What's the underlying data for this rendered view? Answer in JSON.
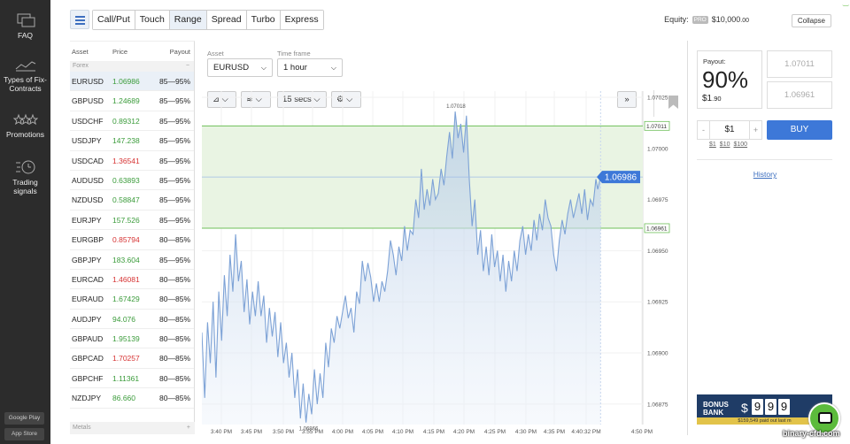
{
  "sidebar": {
    "items": [
      {
        "label": "FAQ",
        "icon": "faq-icon"
      },
      {
        "label": "Types of Fix-Contracts",
        "icon": "chart-icon"
      },
      {
        "label": "Promotions",
        "icon": "stars-icon"
      },
      {
        "label": "Trading signals",
        "icon": "clock-icon"
      }
    ],
    "stores": [
      "Google Play",
      "App Store"
    ]
  },
  "header": {
    "tabs": [
      "Call/Put",
      "Touch",
      "Range",
      "Spread",
      "Turbo",
      "Express"
    ],
    "active_tab": "Range",
    "equity_label": "Equity:",
    "pro_badge": "PRO",
    "equity_value": "$10,000",
    "equity_cents": ".00",
    "collapse_label": "Collapse"
  },
  "assets": {
    "columns": [
      "Asset",
      "Price",
      "Payout"
    ],
    "group": "Forex",
    "group2": "Metals",
    "rows": [
      {
        "name": "EURUSD",
        "price": "1.06986",
        "payout": "85—95%",
        "dir": "up"
      },
      {
        "name": "GBPUSD",
        "price": "1.24689",
        "payout": "85—95%",
        "dir": "up"
      },
      {
        "name": "USDCHF",
        "price": "0.89312",
        "payout": "85—95%",
        "dir": "up"
      },
      {
        "name": "USDJPY",
        "price": "147.238",
        "payout": "85—95%",
        "dir": "up"
      },
      {
        "name": "USDCAD",
        "price": "1.36541",
        "payout": "85—95%",
        "dir": "down"
      },
      {
        "name": "AUDUSD",
        "price": "0.63893",
        "payout": "85—95%",
        "dir": "up"
      },
      {
        "name": "NZDUSD",
        "price": "0.58847",
        "payout": "85—95%",
        "dir": "up"
      },
      {
        "name": "EURJPY",
        "price": "157.526",
        "payout": "85—95%",
        "dir": "up"
      },
      {
        "name": "EURGBP",
        "price": "0.85794",
        "payout": "80—85%",
        "dir": "down"
      },
      {
        "name": "GBPJPY",
        "price": "183.604",
        "payout": "85—95%",
        "dir": "up"
      },
      {
        "name": "EURCAD",
        "price": "1.46081",
        "payout": "80—85%",
        "dir": "down"
      },
      {
        "name": "EURAUD",
        "price": "1.67429",
        "payout": "80—85%",
        "dir": "up"
      },
      {
        "name": "AUDJPY",
        "price": "94.076",
        "payout": "80—85%",
        "dir": "up"
      },
      {
        "name": "GBPAUD",
        "price": "1.95139",
        "payout": "80—85%",
        "dir": "up"
      },
      {
        "name": "GBPCAD",
        "price": "1.70257",
        "payout": "80—85%",
        "dir": "down"
      },
      {
        "name": "GBPCHF",
        "price": "1.11361",
        "payout": "80—85%",
        "dir": "up"
      },
      {
        "name": "NZDJPY",
        "price": "86.660",
        "payout": "80—85%",
        "dir": "up"
      }
    ]
  },
  "controls": {
    "asset_label": "Asset",
    "asset_value": "EURUSD",
    "timeframe_label": "Time frame",
    "timeframe_value": "1 hour",
    "interval": "15 secs"
  },
  "colors": {
    "accent": "#3d78d8",
    "up": "#3a9b3a",
    "down": "#d63333",
    "range": "#6fbf5a"
  },
  "chart_data": {
    "type": "area",
    "x_ticks": [
      "3:40 PM",
      "3:45 PM",
      "3:50 PM",
      "3:55 PM",
      "4:00 PM",
      "4:05 PM",
      "4:10 PM",
      "4:15 PM",
      "4:20 PM",
      "4:25 PM",
      "4:30 PM",
      "4:35 PM",
      "4:40:32 PM",
      "4:50 PM"
    ],
    "y_ticks": [
      "1.07025",
      "1.07000",
      "1.06975",
      "1.06950",
      "1.06925",
      "1.06900",
      "1.06875"
    ],
    "ylim": [
      1.06865,
      1.07028
    ],
    "range_upper": "1.07011",
    "range_lower": "1.06961",
    "current": "1.06986",
    "max_label": "1.07018",
    "min_label": "1.06866",
    "t_start": 38,
    "t_end": 80.5,
    "series": [
      {
        "values": [
          [
            38,
            1.0691
          ],
          [
            38.3,
            1.06878
          ],
          [
            38.6,
            1.06915
          ],
          [
            38.9,
            1.06895
          ],
          [
            39.2,
            1.06925
          ],
          [
            39.5,
            1.06888
          ],
          [
            39.8,
            1.0693
          ],
          [
            40.1,
            1.06906
          ],
          [
            40.4,
            1.06938
          ],
          [
            40.7,
            1.06918
          ],
          [
            41,
            1.06948
          ],
          [
            41.3,
            1.0693
          ],
          [
            41.6,
            1.06958
          ],
          [
            41.9,
            1.06935
          ],
          [
            42.2,
            1.06945
          ],
          [
            42.5,
            1.0692
          ],
          [
            42.8,
            1.06936
          ],
          [
            43.1,
            1.06914
          ],
          [
            43.4,
            1.0693
          ],
          [
            43.7,
            1.06918
          ],
          [
            44,
            1.06935
          ],
          [
            44.3,
            1.06918
          ],
          [
            44.6,
            1.06928
          ],
          [
            44.9,
            1.06905
          ],
          [
            45.2,
            1.06922
          ],
          [
            45.5,
            1.06908
          ],
          [
            45.8,
            1.0692
          ],
          [
            46.1,
            1.06898
          ],
          [
            46.4,
            1.06915
          ],
          [
            46.7,
            1.06895
          ],
          [
            47,
            1.06905
          ],
          [
            47.3,
            1.06888
          ],
          [
            47.6,
            1.069
          ],
          [
            47.9,
            1.06878
          ],
          [
            48.2,
            1.06892
          ],
          [
            48.5,
            1.06868
          ],
          [
            48.8,
            1.06885
          ],
          [
            49.1,
            1.06866
          ],
          [
            49.4,
            1.0688
          ],
          [
            49.7,
            1.0687
          ],
          [
            50,
            1.06892
          ],
          [
            50.3,
            1.06875
          ],
          [
            50.6,
            1.0689
          ],
          [
            50.9,
            1.06878
          ],
          [
            51.2,
            1.06905
          ],
          [
            51.5,
            1.06893
          ],
          [
            51.8,
            1.06912
          ],
          [
            52.1,
            1.06905
          ],
          [
            52.4,
            1.06918
          ],
          [
            52.7,
            1.06912
          ],
          [
            53,
            1.0692
          ],
          [
            53.3,
            1.06928
          ],
          [
            53.6,
            1.06917
          ],
          [
            53.9,
            1.06922
          ],
          [
            54.2,
            1.0691
          ],
          [
            54.5,
            1.0693
          ],
          [
            54.8,
            1.06924
          ],
          [
            55.1,
            1.06945
          ],
          [
            55.4,
            1.06935
          ],
          [
            55.7,
            1.06944
          ],
          [
            56,
            1.06937
          ],
          [
            56.3,
            1.06925
          ],
          [
            56.6,
            1.06934
          ],
          [
            56.9,
            1.06925
          ],
          [
            57.2,
            1.06935
          ],
          [
            57.5,
            1.0693
          ],
          [
            57.8,
            1.0694
          ],
          [
            58.1,
            1.06955
          ],
          [
            58.4,
            1.06948
          ],
          [
            58.7,
            1.06938
          ],
          [
            59,
            1.06952
          ],
          [
            59.3,
            1.06945
          ],
          [
            59.6,
            1.06962
          ],
          [
            59.9,
            1.0695
          ],
          [
            60.2,
            1.0696
          ],
          [
            60.5,
            1.06958
          ],
          [
            60.8,
            1.06975
          ],
          [
            61.1,
            1.06966
          ],
          [
            61.4,
            1.0699
          ],
          [
            61.7,
            1.0697
          ],
          [
            62,
            1.0698
          ],
          [
            62.3,
            1.06972
          ],
          [
            62.6,
            1.06985
          ],
          [
            62.9,
            1.06975
          ],
          [
            63.2,
            1.06978
          ],
          [
            63.5,
            1.0699
          ],
          [
            63.8,
            1.06982
          ],
          [
            64.1,
            1.06996
          ],
          [
            64.4,
            1.07008
          ],
          [
            64.7,
            1.06995
          ],
          [
            65,
            1.07018
          ],
          [
            65.3,
            1.07005
          ],
          [
            65.6,
            1.07012
          ],
          [
            65.9,
            1.06998
          ],
          [
            66.2,
            1.07016
          ],
          [
            66.5,
            1.06985
          ],
          [
            66.8,
            1.06962
          ],
          [
            67.1,
            1.06975
          ],
          [
            67.4,
            1.06948
          ],
          [
            67.7,
            1.0696
          ],
          [
            68,
            1.0694
          ],
          [
            68.3,
            1.06952
          ],
          [
            68.6,
            1.06938
          ],
          [
            68.9,
            1.06958
          ],
          [
            69.2,
            1.06942
          ],
          [
            69.5,
            1.0695
          ],
          [
            69.8,
            1.06935
          ],
          [
            70.1,
            1.06948
          ],
          [
            70.4,
            1.0693
          ],
          [
            70.7,
            1.06945
          ],
          [
            71,
            1.06935
          ],
          [
            71.3,
            1.0695
          ],
          [
            71.6,
            1.0694
          ],
          [
            71.9,
            1.06955
          ],
          [
            72.2,
            1.06962
          ],
          [
            72.5,
            1.06948
          ],
          [
            72.8,
            1.06958
          ],
          [
            73.1,
            1.0695
          ],
          [
            73.4,
            1.06965
          ],
          [
            73.7,
            1.06955
          ],
          [
            74,
            1.06968
          ],
          [
            74.3,
            1.0696
          ],
          [
            74.6,
            1.06975
          ],
          [
            74.9,
            1.06966
          ],
          [
            75.2,
            1.06962
          ],
          [
            75.5,
            1.06948
          ],
          [
            75.8,
            1.0694
          ],
          [
            76.1,
            1.06955
          ],
          [
            76.4,
            1.06965
          ],
          [
            76.7,
            1.06958
          ],
          [
            77,
            1.06968
          ],
          [
            77.3,
            1.06975
          ],
          [
            77.6,
            1.06966
          ],
          [
            77.9,
            1.06972
          ],
          [
            78.2,
            1.06978
          ],
          [
            78.5,
            1.06968
          ],
          [
            78.8,
            1.0698
          ],
          [
            79.1,
            1.06965
          ],
          [
            79.4,
            1.06975
          ],
          [
            79.7,
            1.06972
          ],
          [
            80,
            1.06985
          ],
          [
            80.2,
            1.0698
          ],
          [
            80.5,
            1.06986
          ]
        ]
      }
    ]
  },
  "panel": {
    "payout_label": "Payout:",
    "payout_pct": "90%",
    "payout_amount": "$1",
    "payout_cents": ".90",
    "upper_rate": "1.07011",
    "lower_rate": "1.06961",
    "minus": "-",
    "amount": "$1",
    "plus": "+",
    "quick_amounts": [
      "$1",
      "$10",
      "$100"
    ],
    "buy_label": "BUY",
    "history_label": "History"
  },
  "bonus": {
    "title_line1": "BONUS",
    "title_line2": "BANK",
    "currency": "$",
    "digits": [
      "9",
      "9",
      "9"
    ],
    "subtext": "$159,549 paid out last m"
  },
  "watermark": "binary-cfd.com"
}
